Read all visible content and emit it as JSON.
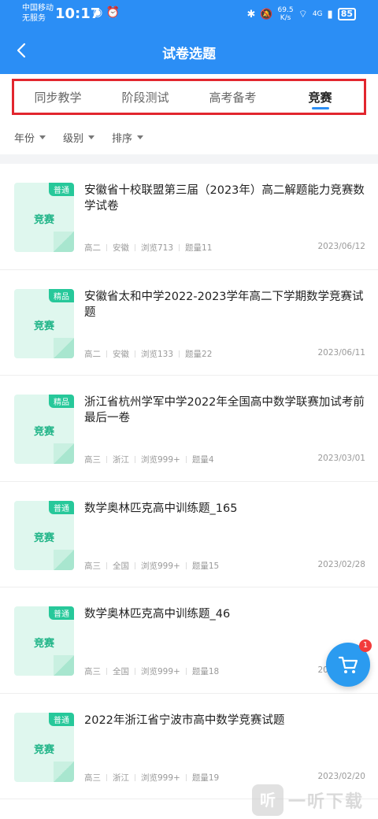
{
  "status_bar": {
    "carrier_line1": "中国移动",
    "carrier_line2": "无服务",
    "time": "10:17",
    "speed_value": "69.5",
    "speed_unit": "K/s",
    "network": "4G",
    "battery": "85"
  },
  "nav": {
    "title": "试卷选题",
    "back_icon": "chevron-left-icon"
  },
  "tabs": [
    {
      "label": "同步教学",
      "active": false
    },
    {
      "label": "阶段测试",
      "active": false
    },
    {
      "label": "高考备考",
      "active": false
    },
    {
      "label": "竞赛",
      "active": true
    }
  ],
  "filters": [
    {
      "label": "年份"
    },
    {
      "label": "级别"
    },
    {
      "label": "排序"
    }
  ],
  "papers": [
    {
      "tag": "普通",
      "cover": "竞赛",
      "title": "安徽省十校联盟第三届（2023年）高二解题能力竞赛数学试卷",
      "grade": "高二",
      "region": "安徽",
      "views": "浏览713",
      "count": "题量11",
      "date": "2023/06/12"
    },
    {
      "tag": "精品",
      "cover": "竞赛",
      "title": "安徽省太和中学2022-2023学年高二下学期数学竞赛试题",
      "grade": "高二",
      "region": "安徽",
      "views": "浏览133",
      "count": "题量22",
      "date": "2023/06/11"
    },
    {
      "tag": "精品",
      "cover": "竞赛",
      "title": "浙江省杭州学军中学2022年全国高中数学联赛加试考前最后一卷",
      "grade": "高三",
      "region": "浙江",
      "views": "浏览999+",
      "count": "题量4",
      "date": "2023/03/01"
    },
    {
      "tag": "普通",
      "cover": "竞赛",
      "title": "数学奥林匹克高中训练题_165",
      "grade": "高三",
      "region": "全国",
      "views": "浏览999+",
      "count": "题量15",
      "date": "2023/02/28"
    },
    {
      "tag": "普通",
      "cover": "竞赛",
      "title": "数学奥林匹克高中训练题_46",
      "grade": "高三",
      "region": "全国",
      "views": "浏览999+",
      "count": "题量18",
      "date": "2023/02/28"
    },
    {
      "tag": "普通",
      "cover": "竞赛",
      "title": "2022年浙江省宁波市高中数学竞赛试题",
      "grade": "高三",
      "region": "浙江",
      "views": "浏览999+",
      "count": "题量19",
      "date": "2023/02/20"
    }
  ],
  "cart": {
    "badge": "1",
    "icon": "cart-icon"
  },
  "watermark": {
    "logo_char": "听",
    "text": "一听下载"
  },
  "colors": {
    "primary": "#2b8ef5",
    "highlight_border": "#e2262e",
    "accent_green": "#27c89a"
  }
}
